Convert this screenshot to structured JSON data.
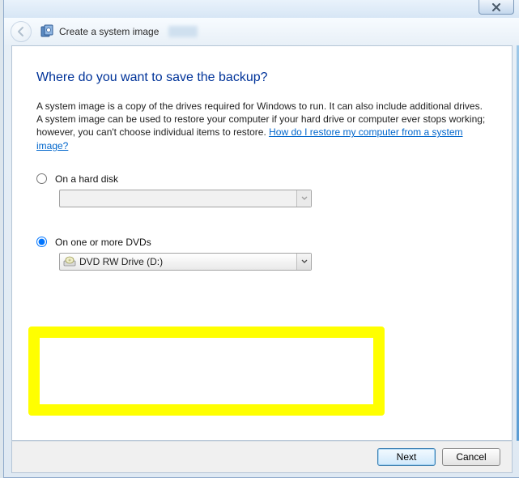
{
  "header": {
    "title": "Create a system image"
  },
  "page": {
    "heading": "Where do you want to save the backup?",
    "description_pre": "A system image is a copy of the drives required for Windows to run. It can also include additional drives. A system image can be used to restore your computer if your hard drive or computer ever stops working; however, you can't choose individual items to restore. ",
    "help_link": "How do I restore my computer from a system image?"
  },
  "options": {
    "hard_disk": {
      "label": "On a hard disk",
      "selected": false,
      "dropdown_value": ""
    },
    "dvd": {
      "label": "On one or more DVDs",
      "selected": true,
      "dropdown_value": "DVD RW Drive (D:)"
    }
  },
  "footer": {
    "next_label": "Next",
    "cancel_label": "Cancel"
  }
}
